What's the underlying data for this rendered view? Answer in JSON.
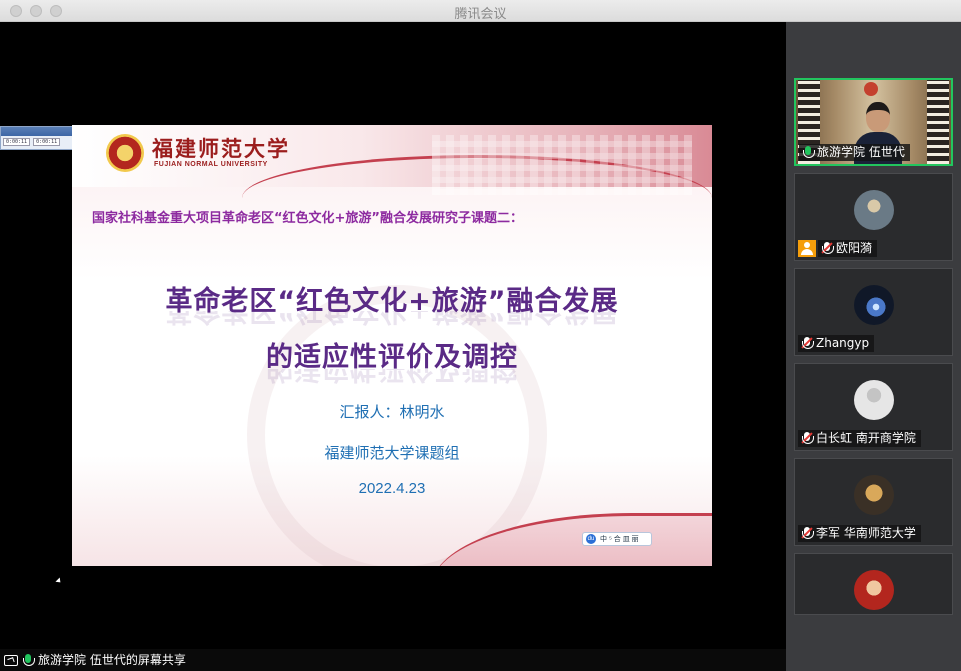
{
  "window": {
    "title": "腾讯会议"
  },
  "mini_panel": {
    "time_a": "0:00:11",
    "time_b": "0:00:11"
  },
  "slide": {
    "school_name_cn": "福建师范大学",
    "school_name_en": "FUJIAN NORMAL UNIVERSITY",
    "project_line": "国家社科基金重大项目革命老区“红色文化+旅游”融合发展研究子课题二：",
    "title_line1": "革命老区“红色文化+旅游”融合发展",
    "title_line2": "的适应性评价及调控",
    "reporter": "汇报人：林明水",
    "group": "福建师范大学课题组",
    "date": "2022.4.23",
    "ime_bar": {
      "logo": "du",
      "items": "中 ⁵ 合 皿 丽"
    }
  },
  "participants": [
    {
      "name": "旅游学院 伍世代",
      "active": true,
      "mic": "active",
      "has_video": true
    },
    {
      "name": "欧阳漪",
      "active": false,
      "mic": "muted",
      "host_badge": true,
      "avatar_color": "#6a7a86"
    },
    {
      "name": "Zhangyp",
      "active": false,
      "mic": "muted",
      "avatar_color": "#101828"
    },
    {
      "name": "白长虹 南开商学院",
      "active": false,
      "mic": "muted",
      "avatar_color": "#e6e6e6"
    },
    {
      "name": "李军 华南师范大学",
      "active": false,
      "mic": "muted",
      "avatar_color": "#3a3026"
    },
    {
      "name": "",
      "active": false,
      "mic": "none",
      "avatar_color": "#b3261e"
    }
  ],
  "bottom_bar": {
    "share_status": "旅游学院 伍世代的屏幕共享"
  },
  "colors": {
    "accent_green": "#22c55e",
    "title_purple": "#5a2a86",
    "body_blue": "#1f6fb3",
    "school_red": "#9b1d1d"
  }
}
